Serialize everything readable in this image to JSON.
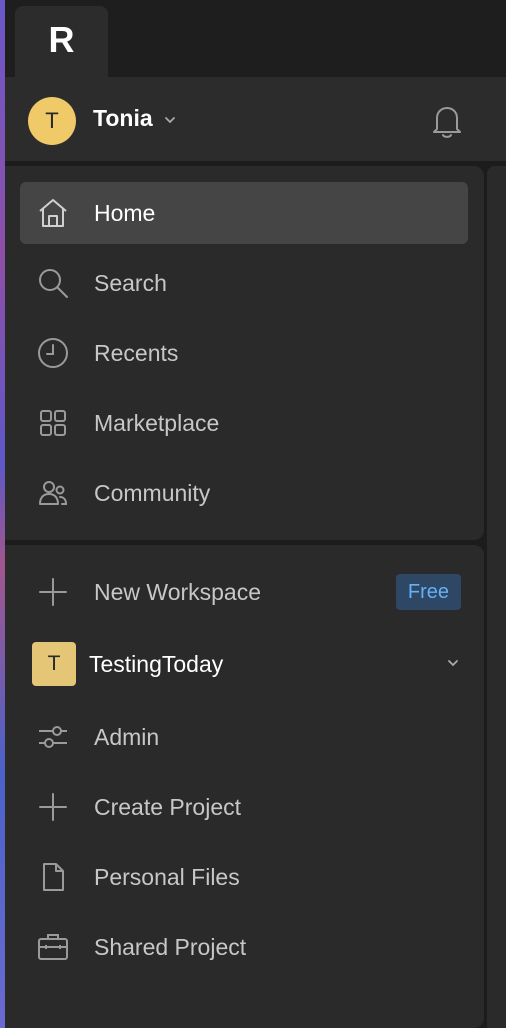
{
  "app": {
    "logo_glyph": "R"
  },
  "user": {
    "initial": "T",
    "name": "Tonia",
    "avatar_color": "#f0c968"
  },
  "nav": {
    "items": [
      {
        "label": "Home",
        "icon": "home-icon",
        "active": true
      },
      {
        "label": "Search",
        "icon": "search-icon"
      },
      {
        "label": "Recents",
        "icon": "clock-icon"
      },
      {
        "label": "Marketplace",
        "icon": "grid-icon"
      },
      {
        "label": "Community",
        "icon": "people-icon"
      }
    ]
  },
  "workspace": {
    "new_label": "New Workspace",
    "new_badge": "Free",
    "current": {
      "initial": "T",
      "name": "TestingToday",
      "color": "#e4c676"
    },
    "items": [
      {
        "label": "Admin",
        "icon": "sliders-icon"
      },
      {
        "label": "Create Project",
        "icon": "plus-icon"
      },
      {
        "label": "Personal Files",
        "icon": "file-icon"
      },
      {
        "label": "Shared Project",
        "icon": "briefcase-icon"
      }
    ]
  },
  "colors": {
    "accent_badge_bg": "#2d4764",
    "accent_badge_text": "#66b0f8"
  }
}
